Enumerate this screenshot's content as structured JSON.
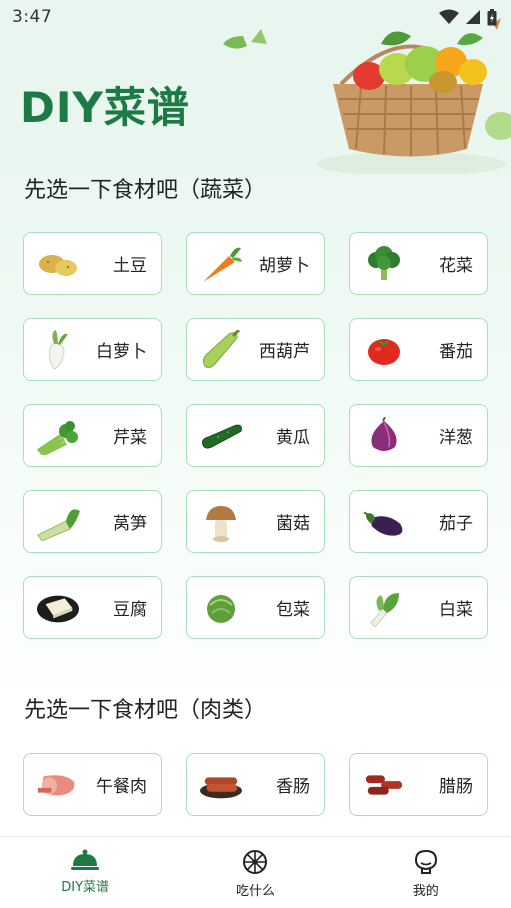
{
  "status_bar": {
    "time": "3:47"
  },
  "header": {
    "title": "DIY菜谱"
  },
  "sections": {
    "vegetables": {
      "title": "先选一下食材吧（蔬菜）",
      "items": [
        {
          "label": "土豆",
          "icon": "potato-icon"
        },
        {
          "label": "胡萝卜",
          "icon": "carrot-icon"
        },
        {
          "label": "花菜",
          "icon": "broccoli-icon"
        },
        {
          "label": "白萝卜",
          "icon": "radish-icon"
        },
        {
          "label": "西葫芦",
          "icon": "zucchini-icon"
        },
        {
          "label": "番茄",
          "icon": "tomato-icon"
        },
        {
          "label": "芹菜",
          "icon": "celery-icon"
        },
        {
          "label": "黄瓜",
          "icon": "cucumber-icon"
        },
        {
          "label": "洋葱",
          "icon": "onion-icon"
        },
        {
          "label": "莴笋",
          "icon": "lettuce-stem-icon"
        },
        {
          "label": "菌菇",
          "icon": "mushroom-icon"
        },
        {
          "label": "茄子",
          "icon": "eggplant-icon"
        },
        {
          "label": "豆腐",
          "icon": "tofu-icon"
        },
        {
          "label": "包菜",
          "icon": "cabbage-icon"
        },
        {
          "label": "白菜",
          "icon": "bok-choy-icon"
        }
      ]
    },
    "meat": {
      "title": "先选一下食材吧（肉类）",
      "items": [
        {
          "label": "午餐肉",
          "icon": "luncheon-meat-icon"
        },
        {
          "label": "香肠",
          "icon": "sausage-icon"
        },
        {
          "label": "腊肠",
          "icon": "cured-sausage-icon"
        }
      ]
    }
  },
  "bottom_nav": {
    "items": [
      {
        "label": "DIY菜谱",
        "icon": "cloche-icon",
        "active": true
      },
      {
        "label": "吃什么",
        "icon": "wheel-icon",
        "active": false
      },
      {
        "label": "我的",
        "icon": "profile-icon",
        "active": false
      }
    ]
  },
  "colors": {
    "accent": "#1d7a45",
    "card_border": "#a9ddbf"
  }
}
